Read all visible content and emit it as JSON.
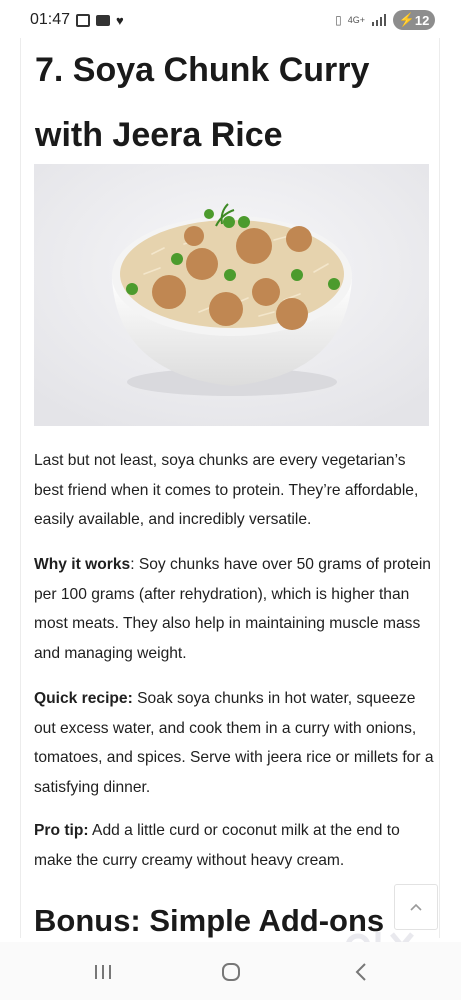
{
  "status_bar": {
    "time": "01:47",
    "network": "4G+",
    "battery": "12",
    "icons": [
      "screenshot-icon",
      "youtube-icon",
      "heart-icon",
      "vibrate-icon",
      "signal-icon",
      "battery-icon"
    ]
  },
  "article": {
    "title": "7. Soya Chunk Curry with Jeera Rice",
    "image": "soya-chunk-jeera-rice-bowl",
    "intro": "Last but not least, soya chunks are every vegetarian’s best friend when it comes to protein. They’re affordable, easily available, and incredibly versatile.",
    "why": {
      "label": "Why it works",
      "text": ": Soy chunks have over 50 grams of protein per 100 grams (after rehydration), which is higher than most meats. They also help in maintaining muscle mass and managing weight."
    },
    "recipe": {
      "label": "Quick recipe:",
      "text": " Soak soya chunks in hot water, squeeze out excess water, and cook them in a curry with onions, tomatoes, and spices. Serve with jeera rice or millets for a satisfying dinner."
    },
    "tip": {
      "label": "Pro tip:",
      "text": " Add a little curd or coconut milk at the end to make the curry creamy without heavy cream."
    },
    "next_heading": "Bonus: Simple Add-ons"
  },
  "overlay": {
    "watermark": "olx",
    "scroll_top_icon": "chevron-up-icon"
  },
  "nav": {
    "icons": [
      "recent-apps-icon",
      "home-icon",
      "back-icon"
    ]
  },
  "colors": {
    "text": "#1f1f1f",
    "battery_bg": "#8d8d8d",
    "rice": "#e8d7b6",
    "soya": "#c48c58",
    "peas": "#4a9a2c"
  }
}
